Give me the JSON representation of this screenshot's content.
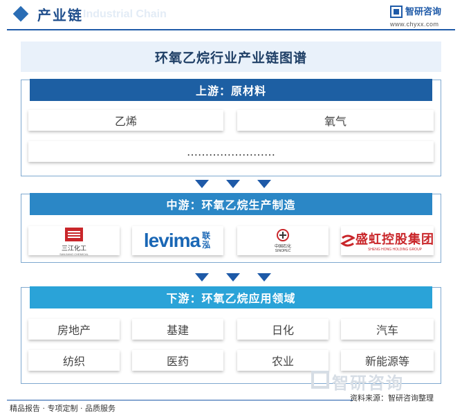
{
  "header": {
    "section_title": "产业链",
    "section_title_en": "Industrial Chain",
    "brand_name": "智研咨询",
    "brand_url": "www.chyxx.com"
  },
  "title": "环氧乙烷行业产业链图谱",
  "upstream": {
    "heading": "上游：原材料",
    "items": [
      "乙烯",
      "氧气"
    ],
    "more": "……………………"
  },
  "midstream": {
    "heading": "中游：环氧乙烷生产制造",
    "companies": [
      {
        "logo_text": "三江化工",
        "logo_sub": "SANJIANG CHEMICAL",
        "icon": "sanjiang-logo"
      },
      {
        "logo_text": "levima",
        "logo_sub": "联泓",
        "icon": "levima-logo"
      },
      {
        "logo_text": "中国石化",
        "logo_sub": "SINOPEC",
        "icon": "sinopec-logo"
      },
      {
        "logo_text": "盛虹控股集团",
        "logo_sub": "SHENG HONG HOLDING GROUP",
        "icon": "shenghong-logo"
      }
    ]
  },
  "downstream": {
    "heading": "下游：环氧乙烷应用领域",
    "items": [
      "房地产",
      "基建",
      "日化",
      "汽车",
      "纺织",
      "医药",
      "农业",
      "新能源等"
    ]
  },
  "footer": {
    "watermark": "智研咨询",
    "source": "资料来源：智研咨询整理",
    "tagline": "精品报告 · 专项定制 · 品质服务"
  },
  "colors": {
    "upstream_head": "#1d5fa3",
    "midstream_head": "#2b87c6",
    "downstream_head": "#2aa3d8",
    "arrow": "#1e5aa8"
  }
}
